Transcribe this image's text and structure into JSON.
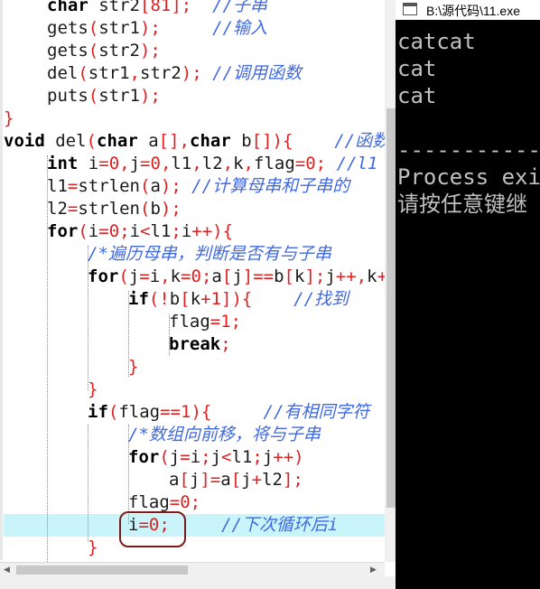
{
  "editor": {
    "lines": [
      {
        "top": "-6",
        "html": "<span class='kw'>char</span> <span class='id'>str2</span><span class='pu'>[</span><span class='num'>81</span><span class='pu'>];</span>  <span class='cm'>//子串</span>"
      },
      {
        "top": "19",
        "html": "<span class='fn'>gets</span><span class='pu'>(</span><span class='id'>str1</span><span class='pu'>);</span>     <span class='cm'>//输入</span>"
      },
      {
        "top": "44",
        "html": "<span class='fn'>gets</span><span class='pu'>(</span><span class='id'>str2</span><span class='pu'>);</span>"
      },
      {
        "top": "69",
        "html": "<span class='fn'>del</span><span class='pu'>(</span><span class='id'>str1</span><span class='pu'>,</span><span class='id'>str2</span><span class='pu'>);</span> <span class='cm'>//调用函数</span>"
      },
      {
        "top": "94",
        "html": "<span class='fn'>puts</span><span class='pu'>(</span><span class='id'>str1</span><span class='pu'>);</span>"
      },
      {
        "top": "119",
        "html": "<span class='pu'>}</span>"
      },
      {
        "top": "144",
        "html": "<span class='kw'>void</span> <span class='fn'>del</span><span class='pu'>(</span><span class='kw'>char</span> <span class='id'>a</span><span class='pu'>[],</span><span class='kw'>char</span> <span class='id'>b</span><span class='pu'>[]){</span>    <span class='cm'>//函数</span>"
      },
      {
        "top": "169",
        "html": "<span class='kw'>int</span> <span class='id'>i</span><span class='pu'>=</span><span class='num'>0</span><span class='pu'>,</span><span class='id'>j</span><span class='pu'>=</span><span class='num'>0</span><span class='pu'>,</span><span class='id'>l1</span><span class='pu'>,</span><span class='id'>l2</span><span class='pu'>,</span><span class='id'>k</span><span class='pu'>,</span><span class='id'>flag</span><span class='pu'>=</span><span class='num'>0</span><span class='pu'>;</span> <span class='cm'>//l1</span>"
      },
      {
        "top": "194",
        "html": "<span class='id'>l1</span><span class='pu'>=</span><span class='fn'>strlen</span><span class='pu'>(</span><span class='id'>a</span><span class='pu'>);</span> <span class='cm'>//计算母串和子串的</span>"
      },
      {
        "top": "219",
        "html": "<span class='id'>l2</span><span class='pu'>=</span><span class='fn'>strlen</span><span class='pu'>(</span><span class='id'>b</span><span class='pu'>);</span>"
      },
      {
        "top": "244",
        "html": "<span class='kw'>for</span><span class='pu'>(</span><span class='id'>i</span><span class='pu'>=</span><span class='num'>0</span><span class='pu'>;</span><span class='id'>i</span><span class='pu'>&lt;</span><span class='id'>l1</span><span class='pu'>;</span><span class='id'>i</span><span class='pu'>++){</span>"
      },
      {
        "top": "269",
        "html": "<span class='cm'>/*遍历母串，判断是否有与子串</span>"
      },
      {
        "top": "294",
        "html": "<span class='kw'>for</span><span class='pu'>(</span><span class='id'>j</span><span class='pu'>=</span><span class='id'>i</span><span class='pu'>,</span><span class='id'>k</span><span class='pu'>=</span><span class='num'>0</span><span class='pu'>;</span><span class='id'>a</span><span class='pu'>[</span><span class='id'>j</span><span class='pu'>]==</span><span class='id'>b</span><span class='pu'>[</span><span class='id'>k</span><span class='pu'>];</span><span class='id'>j</span><span class='pu'>++,</span><span class='id'>k</span><span class='pu'>+</span>"
      },
      {
        "top": "319",
        "html": "<span class='kw'>if</span><span class='pu'>(!</span><span class='id'>b</span><span class='pu'>[</span><span class='id'>k</span><span class='pu'>+</span><span class='num'>1</span><span class='pu'>]){</span>    <span class='cm'>//找到</span>"
      },
      {
        "top": "344",
        "html": "<span class='id'>flag</span><span class='pu'>=</span><span class='num'>1</span><span class='pu'>;</span>"
      },
      {
        "top": "369",
        "html": "<span class='kw'>break</span><span class='pu'>;</span>"
      },
      {
        "top": "394",
        "html": "<span class='pu'>}</span>"
      },
      {
        "top": "419",
        "html": "<span class='pu'>}</span>"
      },
      {
        "top": "444",
        "html": "<span class='kw'>if</span><span class='pu'>(</span><span class='id'>flag</span><span class='pu'>==</span><span class='num'>1</span><span class='pu'>){</span>     <span class='cm'>//有相同字符</span>"
      },
      {
        "top": "469",
        "html": "<span class='cm'>/*数组向前移，将与子串</span>"
      },
      {
        "top": "494",
        "html": "<span class='kw'>for</span><span class='pu'>(</span><span class='id'>j</span><span class='pu'>=</span><span class='id'>i</span><span class='pu'>;</span><span class='id'>j</span><span class='pu'>&lt;</span><span class='id'>l1</span><span class='pu'>;</span><span class='id'>j</span><span class='pu'>++)</span>"
      },
      {
        "top": "519",
        "html": "<span class='id'>a</span><span class='pu'>[</span><span class='id'>j</span><span class='pu'>]=</span><span class='id'>a</span><span class='pu'>[</span><span class='id'>j</span><span class='pu'>+</span><span class='id'>l2</span><span class='pu'>];</span>"
      },
      {
        "top": "544",
        "html": "<span class='id'>flag</span><span class='pu'>=</span><span class='num'>0</span><span class='pu'>;</span>"
      },
      {
        "top": "569",
        "html": "<span class='id'>i</span><span class='pu'>=</span><span class='num'>0</span><span class='pu'>;</span>     <span class='cm'>//下次循环后i</span>"
      },
      {
        "top": "594",
        "html": "<span class='pu'>}</span>"
      }
    ]
  },
  "console": {
    "title": "B:\\源代码\\11.exe",
    "output": [
      "catcat",
      "cat",
      "cat",
      "",
      "--------------",
      "Process exi",
      "请按任意键继"
    ]
  }
}
